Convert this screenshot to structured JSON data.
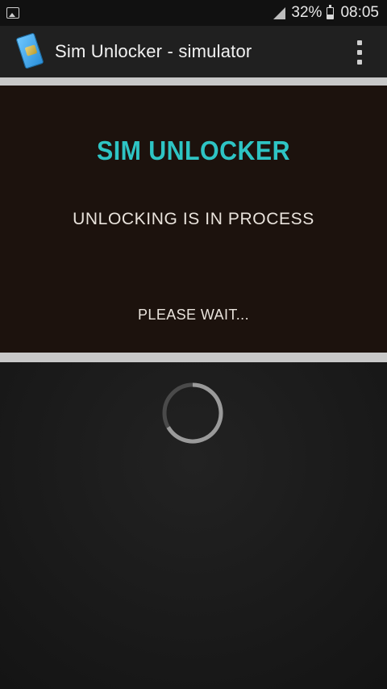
{
  "status_bar": {
    "battery_percent": "32%",
    "time": "08:05",
    "icons": [
      "gallery-icon",
      "signal-icon",
      "battery-icon"
    ]
  },
  "app_bar": {
    "title": "Sim Unlocker - simulator",
    "logo_icon": "sim-card-icon",
    "menu_icon": "overflow-menu-icon"
  },
  "panel": {
    "heading": "SIM UNLOCKER",
    "status": "UNLOCKING IS IN PROCESS",
    "wait": "PLEASE WAIT..."
  },
  "colors": {
    "heading": "#2ec4c4",
    "panel_background": "#1c120d",
    "divider": "#c8c8c8"
  }
}
